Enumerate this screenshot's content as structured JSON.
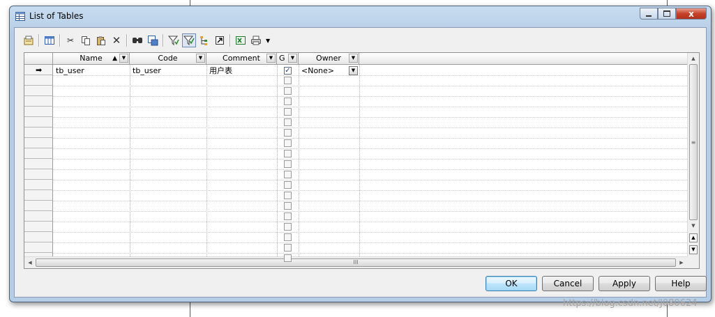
{
  "window": {
    "title": "List of Tables",
    "close_glyph": "x",
    "minimize_icon": "minimize-icon",
    "maximize_icon": "maximize-icon"
  },
  "toolbar": {
    "icons": [
      "properties-icon",
      "customize-columns-icon",
      "cut-icon",
      "copy-icon",
      "paste-icon",
      "delete-icon",
      "find-icon",
      "find-replace-icon",
      "filter-icon",
      "enable-filter-icon",
      "sort-hierarchy-icon",
      "go-to-object-icon",
      "export-excel-icon",
      "print-icon",
      "more-dropdown-icon"
    ]
  },
  "grid": {
    "columns": [
      {
        "label": "Name",
        "sorted": "ascending"
      },
      {
        "label": "Code"
      },
      {
        "label": "Comment"
      },
      {
        "label": "G"
      },
      {
        "label": "Owner"
      }
    ],
    "rows": [
      {
        "name": "tb_user",
        "code": "tb_user",
        "comment": "用户表",
        "generate": true,
        "owner": "<None>"
      }
    ],
    "current_row_marker": "➡",
    "scroll_thumb_grip": "≡",
    "hscroll_thumb_grip": "III"
  },
  "buttons": {
    "ok": "OK",
    "cancel": "Cancel",
    "apply": "Apply",
    "help": "Help"
  },
  "watermark": "https://blog.csdn.net/J080624"
}
